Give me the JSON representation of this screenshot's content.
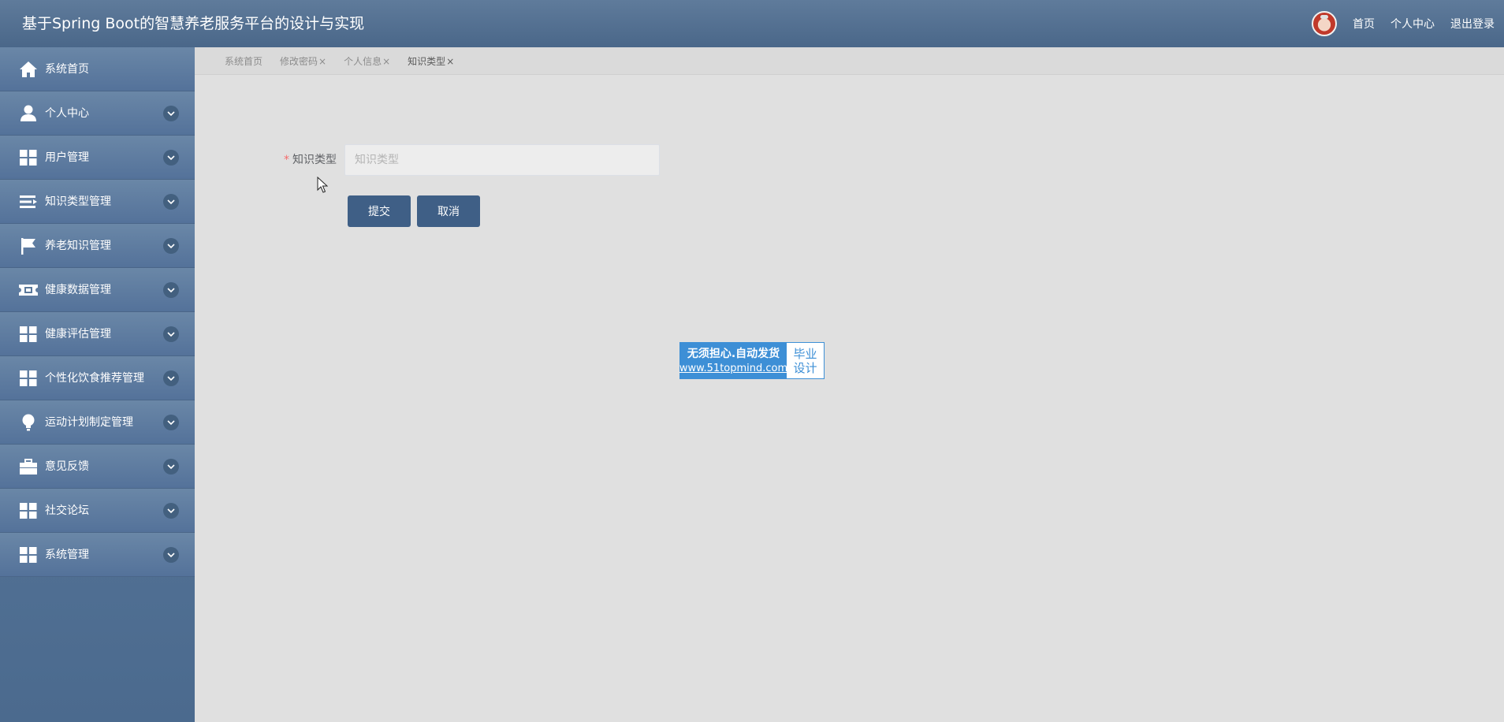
{
  "header": {
    "title": "基于Spring Boot的智慧养老服务平台的设计与实现",
    "links": [
      "首页",
      "个人中心",
      "退出登录"
    ]
  },
  "sidebar": {
    "items": [
      {
        "label": "系统首页",
        "icon": "home-icon"
      },
      {
        "label": "个人中心",
        "icon": "user-icon"
      },
      {
        "label": "用户管理",
        "icon": "grid-icon"
      },
      {
        "label": "知识类型管理",
        "icon": "list-icon"
      },
      {
        "label": "养老知识管理",
        "icon": "flag-icon"
      },
      {
        "label": "健康数据管理",
        "icon": "ticket-icon"
      },
      {
        "label": "健康评估管理",
        "icon": "grid-icon"
      },
      {
        "label": "个性化饮食推荐管理",
        "icon": "grid-icon"
      },
      {
        "label": "运动计划制定管理",
        "icon": "bulb-icon"
      },
      {
        "label": "意见反馈",
        "icon": "briefcase-icon"
      },
      {
        "label": "社交论坛",
        "icon": "grid-icon"
      },
      {
        "label": "系统管理",
        "icon": "grid-icon"
      }
    ]
  },
  "tabs": [
    {
      "label": "系统首页",
      "closable": false
    },
    {
      "label": "修改密码",
      "closable": true
    },
    {
      "label": "个人信息",
      "closable": true
    },
    {
      "label": "知识类型",
      "closable": true,
      "active": true
    }
  ],
  "tab_close_glyph": "×",
  "form": {
    "required_mark": "*",
    "label": "知识类型",
    "value": "",
    "placeholder": "知识类型",
    "submit_label": "提交",
    "cancel_label": "取消"
  },
  "badge": {
    "line1": "无须担心.自动发货",
    "line2": "www.51topmind.com",
    "right_top": "毕业",
    "right_bottom": "设计"
  },
  "colors": {
    "header": "#4f6c8f",
    "sidebar": "#5a789b",
    "button": "#3f5f86",
    "content_bg": "#e0e0e0",
    "required": "#f56c6c",
    "badge": "#3d8fd6"
  }
}
